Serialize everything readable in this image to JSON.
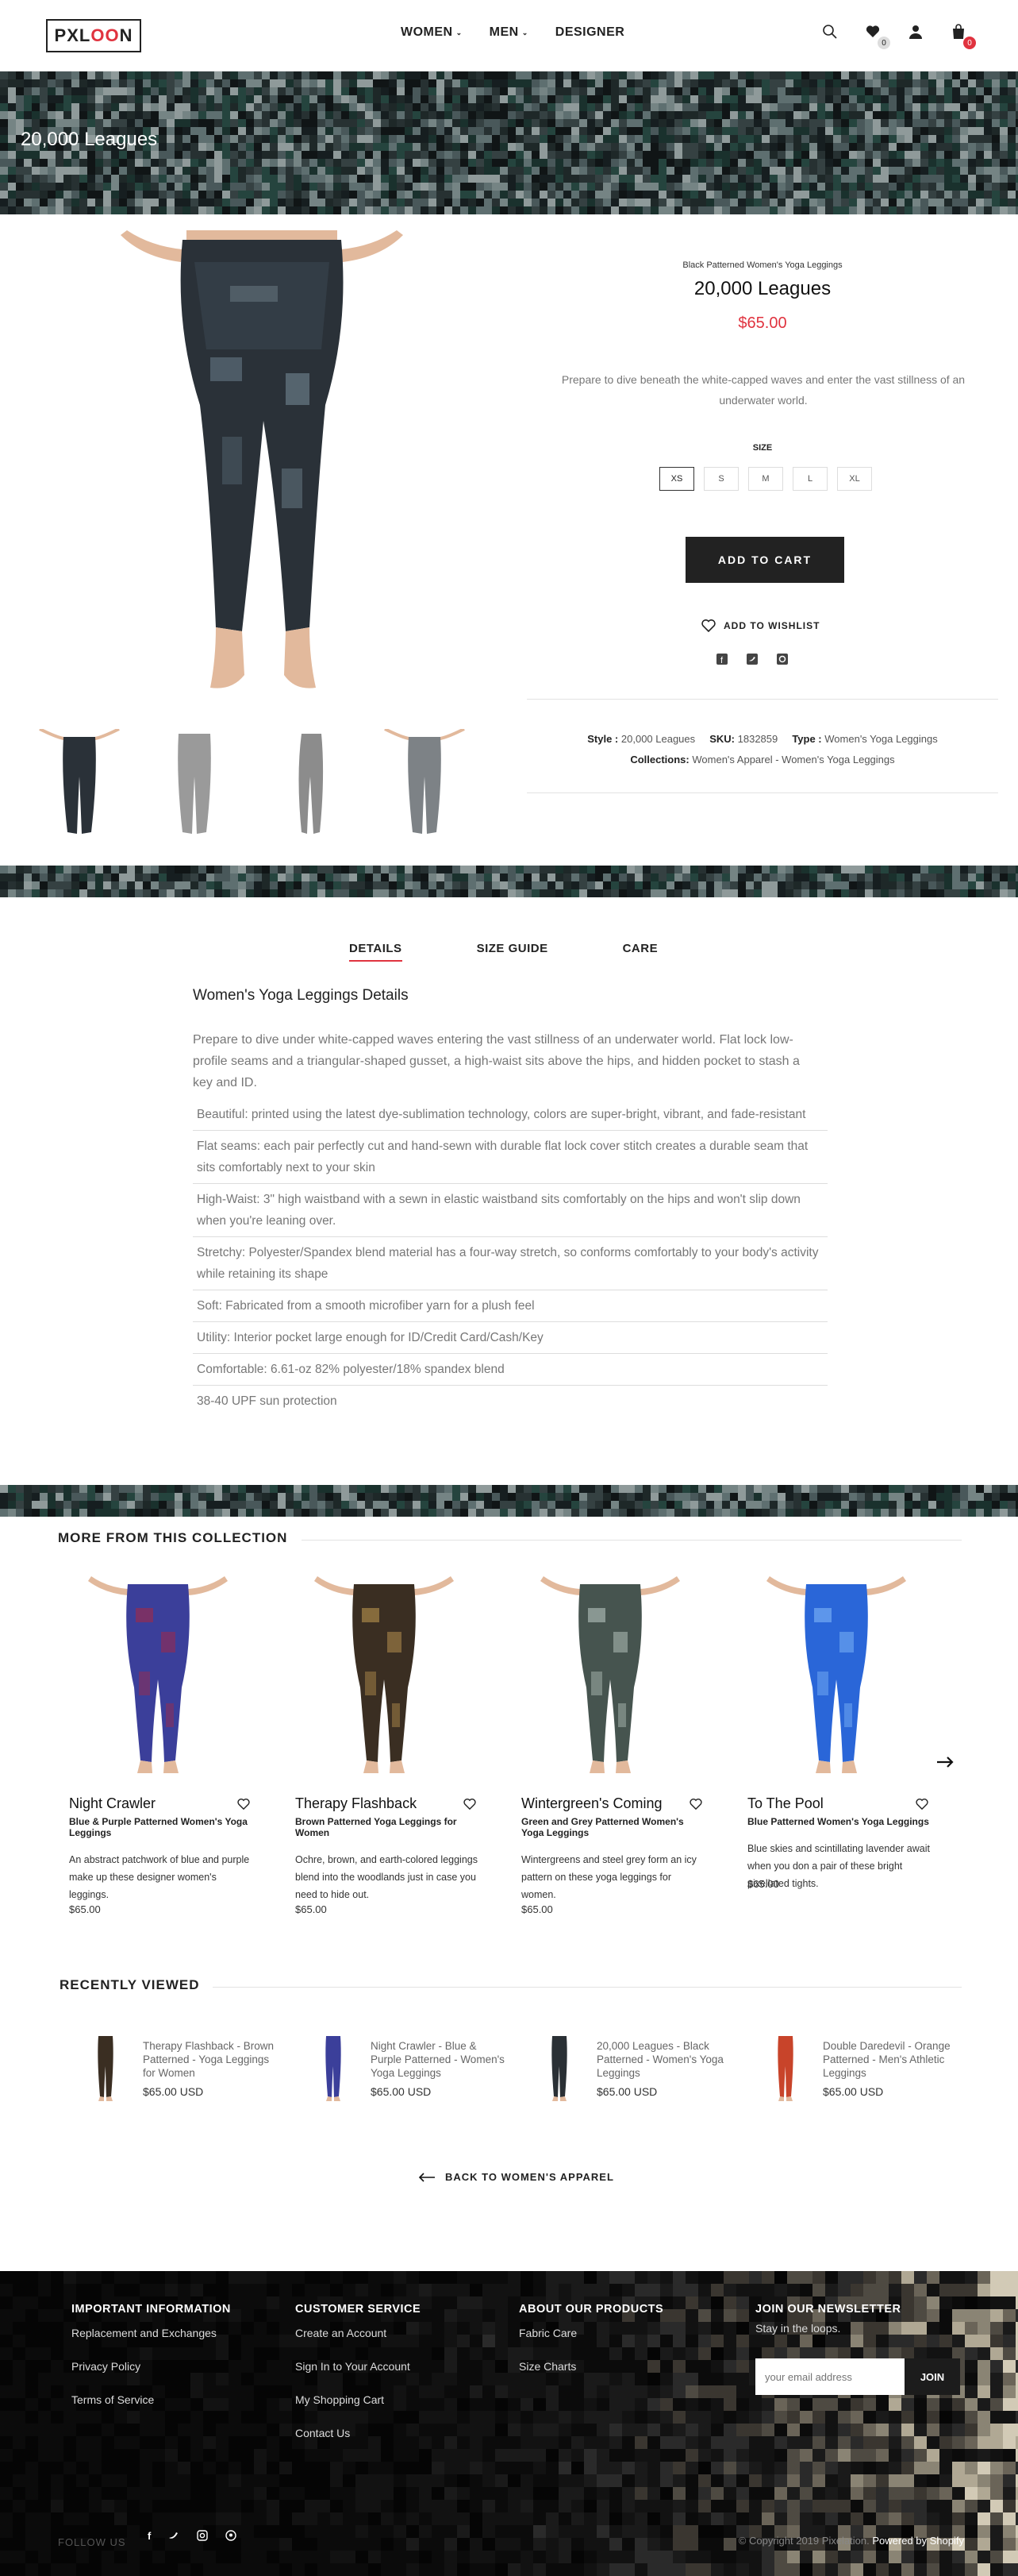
{
  "header": {
    "logo": {
      "part1": "PXL",
      "part2": "OO",
      "part3": "N"
    },
    "nav": [
      {
        "label": "WOMEN",
        "dropdown": true
      },
      {
        "label": "MEN",
        "dropdown": true
      },
      {
        "label": "DESIGNER",
        "dropdown": false
      }
    ],
    "icons": [
      "search-icon",
      "heart-icon",
      "user-icon",
      "bag-icon"
    ],
    "wishlist_count": "0",
    "cart_count": "0"
  },
  "hero": {
    "title": "20,000 Leagues"
  },
  "product": {
    "subtitle": "Black Patterned Women's Yoga Leggings",
    "title": "20,000 Leagues",
    "price": "$65.00",
    "description": "Prepare to dive beneath the white-capped waves and enter the vast stillness of an underwater world.",
    "size_label": "SIZE",
    "sizes": [
      "XS",
      "S",
      "M",
      "L",
      "XL"
    ],
    "selected_size": "XS",
    "add_to_cart": "ADD TO CART",
    "add_to_wishlist": "ADD TO WISHLIST",
    "share_icons": [
      "facebook-icon",
      "twitter-icon",
      "pinterest-icon"
    ],
    "meta": {
      "style_label": "Style :",
      "style_value": "20,000 Leagues",
      "sku_label": "SKU:",
      "sku_value": "1832859",
      "type_label": "Type :",
      "type_value": "Women's Yoga Leggings",
      "collections_label": "Collections:",
      "collections_value": "Women's Apparel - Women's Yoga Leggings"
    }
  },
  "tabs": [
    {
      "label": "DETAILS",
      "active": true
    },
    {
      "label": "SIZE GUIDE",
      "active": false
    },
    {
      "label": "CARE",
      "active": false
    }
  ],
  "details": {
    "title": "Women's Yoga Leggings Details",
    "intro": "Prepare to dive under white-capped waves entering the vast stillness of an underwater world. Flat lock low-profile seams and a triangular-shaped gusset, a high-waist sits above the hips, and hidden pocket to stash a key and ID.",
    "items": [
      "Beautiful: printed using the latest dye-sublimation technology, colors are super-bright, vibrant, and fade-resistant",
      "Flat seams: each pair perfectly cut and hand-sewn with durable flat lock cover stitch creates a durable seam that sits comfortably next to your skin",
      "High-Waist: 3\" high waistband with a sewn in elastic waistband sits comfortably on the hips and won't slip down when you're leaning over.",
      "Stretchy: Polyester/Spandex blend material has a four-way stretch, so conforms comfortably to your body's activity while retaining its shape",
      "Soft: Fabricated from a smooth microfiber yarn for a plush feel",
      "Utility: Interior pocket large enough for ID/Credit Card/Cash/Key",
      "Comfortable: 6.61-oz 82% polyester/18% spandex blend",
      "38-40 UPF sun protection"
    ]
  },
  "collection": {
    "title": "MORE FROM THIS COLLECTION",
    "items": [
      {
        "name": "Night Crawler",
        "subtitle": "Blue & Purple Patterned Women's Yoga Leggings",
        "description": "An abstract patchwork of blue and purple make up these designer women's leggings.",
        "price": "$65.00",
        "color": "#3b3f9a",
        "accent": "#8a2e5a"
      },
      {
        "name": "Therapy Flashback",
        "subtitle": "Brown Patterned Yoga Leggings for Women",
        "description": "Ochre, brown, and earth-colored leggings blend into the woodlands just in case you need to hide out.",
        "price": "$65.00",
        "color": "#3a2e22",
        "accent": "#9a7a44"
      },
      {
        "name": "Wintergreen's Coming",
        "subtitle": "Green and Grey Patterned Women's Yoga Leggings",
        "description": "Wintergreens and steel grey form an icy pattern on these yoga leggings for women.",
        "price": "$65.00",
        "color": "#46544f",
        "accent": "#9aa8a2"
      },
      {
        "name": "To The Pool",
        "subtitle": "Blue Patterned Women's Yoga Leggings",
        "description": "Blue skies and scintillating lavender await when you don a pair of these bright pixellated tights.",
        "price": "$65.00",
        "color": "#2a66d8",
        "accent": "#6aa2f0"
      }
    ]
  },
  "recently_viewed": {
    "title": "RECENTLY VIEWED",
    "items": [
      {
        "title": "Therapy Flashback - Brown Patterned - Yoga Leggings for Women",
        "price": "$65.00 USD",
        "color": "#3a2e22"
      },
      {
        "title": "Night Crawler - Blue & Purple Patterned - Women's Yoga Leggings",
        "price": "$65.00 USD",
        "color": "#3b3f9a"
      },
      {
        "title": "20,000 Leagues - Black Patterned - Women's Yoga Leggings",
        "price": "$65.00 USD",
        "color": "#2a3035"
      },
      {
        "title": "Double Daredevil - Orange Patterned - Men's Athletic Leggings",
        "price": "$65.00 USD",
        "color": "#c8442a"
      }
    ]
  },
  "back_link": "BACK TO WOMEN'S APPAREL",
  "footer": {
    "columns": [
      {
        "heading": "IMPORTANT INFORMATION",
        "links": [
          "Replacement and Exchanges",
          "Privacy Policy",
          "Terms of Service"
        ]
      },
      {
        "heading": "CUSTOMER SERVICE",
        "links": [
          "Create an Account",
          "Sign In to Your Account",
          "My Shopping Cart",
          "Contact Us"
        ]
      },
      {
        "heading": "ABOUT OUR PRODUCTS",
        "links": [
          "Fabric Care",
          "Size Charts"
        ]
      }
    ],
    "newsletter": {
      "heading": "JOIN OUR NEWSLETTER",
      "subtitle": "Stay in the loops.",
      "placeholder": "your email address",
      "button": "JOIN"
    },
    "follow_label": "FOLLOW US",
    "social": [
      "facebook-icon",
      "twitter-icon",
      "instagram-icon",
      "pinterest-icon"
    ],
    "copyright": "© Copyright 2019 Pixelation.",
    "powered": "Powered by Shopify"
  },
  "colors": {
    "accent": "#e0333f",
    "dark": "#222222",
    "banner": "#2e3a3b"
  }
}
